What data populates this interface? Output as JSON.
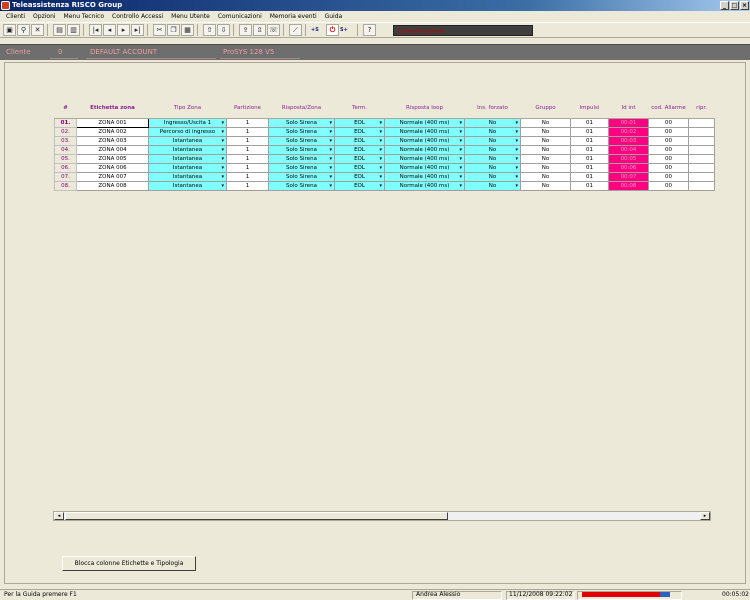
{
  "window": {
    "title": "Teleassistenza RISCO Group",
    "controls": [
      "_",
      "□",
      "×"
    ]
  },
  "menu": [
    "Clienti",
    "Opzioni",
    "Menu Tecnico",
    "Controllo Accessi",
    "Menu Utente",
    "Comunicazioni",
    "Memoria eventi",
    "Guida"
  ],
  "toolbar": {
    "status_text": "Comunicazione",
    "text_buttons": [
      "+S",
      "S+"
    ]
  },
  "client": {
    "label": "Cliente",
    "id": "0",
    "account": "DEFAULT ACCOUNT",
    "system": "ProSYS 128 V5"
  },
  "grid": {
    "headers": [
      "#",
      "Etichetta zona",
      "Tipo Zona",
      "Partizione",
      "Risposta/Zona",
      "Term.",
      "Risposta loop",
      "Ins. forzato",
      "Gruppo",
      "Impulsi",
      "Id int",
      "cod. Allarme",
      "ripr."
    ],
    "rows": [
      {
        "num": "01.",
        "label": "ZONA 001",
        "tipo": "Ingresso/Uscita 1",
        "part": "1",
        "risposta": "Solo Sirena",
        "term": "EOL",
        "loop": "Normale (400 ms)",
        "forzato": "No",
        "gruppo": "No",
        "impulsi": "01",
        "idint": "00:01",
        "cod": "00"
      },
      {
        "num": "02.",
        "label": "ZONA 002",
        "tipo": "Percorso di ingresso",
        "part": "1",
        "risposta": "Solo Sirena",
        "term": "EOL",
        "loop": "Normale (400 ms)",
        "forzato": "No",
        "gruppo": "No",
        "impulsi": "01",
        "idint": "00:02",
        "cod": "00"
      },
      {
        "num": "03.",
        "label": "ZONA 003",
        "tipo": "Istantanea",
        "part": "1",
        "risposta": "Solo Sirena",
        "term": "EOL",
        "loop": "Normale (400 ms)",
        "forzato": "No",
        "gruppo": "No",
        "impulsi": "01",
        "idint": "00:03",
        "cod": "00"
      },
      {
        "num": "04.",
        "label": "ZONA 004",
        "tipo": "Istantanea",
        "part": "1",
        "risposta": "Solo Sirena",
        "term": "EOL",
        "loop": "Normale (400 ms)",
        "forzato": "No",
        "gruppo": "No",
        "impulsi": "01",
        "idint": "00:04",
        "cod": "00"
      },
      {
        "num": "05.",
        "label": "ZONA 005",
        "tipo": "Istantanea",
        "part": "1",
        "risposta": "Solo Sirena",
        "term": "EOL",
        "loop": "Normale (400 ms)",
        "forzato": "No",
        "gruppo": "No",
        "impulsi": "01",
        "idint": "00:05",
        "cod": "00"
      },
      {
        "num": "06.",
        "label": "ZONA 006",
        "tipo": "Istantanea",
        "part": "1",
        "risposta": "Solo Sirena",
        "term": "EOL",
        "loop": "Normale (400 ms)",
        "forzato": "No",
        "gruppo": "No",
        "impulsi": "01",
        "idint": "00:06",
        "cod": "00"
      },
      {
        "num": "07.",
        "label": "ZONA 007",
        "tipo": "Istantanea",
        "part": "1",
        "risposta": "Solo Sirena",
        "term": "EOL",
        "loop": "Normale (400 ms)",
        "forzato": "No",
        "gruppo": "No",
        "impulsi": "01",
        "idint": "00:07",
        "cod": "00"
      },
      {
        "num": "08.",
        "label": "ZONA 008",
        "tipo": "Istantanea",
        "part": "1",
        "risposta": "Solo Sirena",
        "term": "EOL",
        "loop": "Normale (400 ms)",
        "forzato": "No",
        "gruppo": "No",
        "impulsi": "01",
        "idint": "00:08",
        "cod": "00"
      }
    ]
  },
  "lock_button": "Blocca colonne Etichette e Tipologia",
  "status": {
    "help": "Per la Guida premere F1",
    "user": "Andrea Alessio",
    "datetime": "11/12/2008 09:22:02",
    "elapsed": "00:05:02"
  },
  "colors": {
    "cyan_cell": "#80ffff",
    "magenta_cell": "#ff0080",
    "header_text": "#8a2090"
  }
}
